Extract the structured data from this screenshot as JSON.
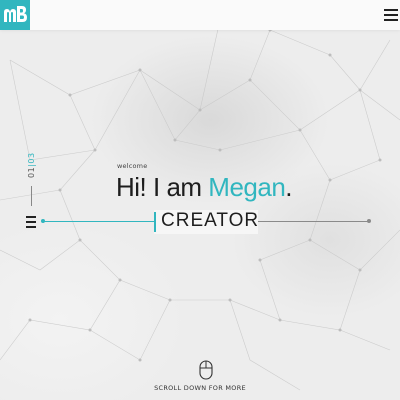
{
  "header": {
    "logo_text": "MB",
    "menu_icon": "hamburger-icon"
  },
  "slide_counter": {
    "current": "01",
    "separator": "|",
    "total": "03"
  },
  "hero": {
    "welcome": "welcome",
    "greeting": "Hi! I am ",
    "name": "Megan",
    "punctuation": ".",
    "role": "CREATOR"
  },
  "scroll_hint": {
    "icon": "mouse-icon",
    "label": "SCROLL DOWN FOR MORE"
  },
  "colors": {
    "accent": "#31b6bf",
    "text": "#1d1d1d",
    "background": "#ededed"
  }
}
